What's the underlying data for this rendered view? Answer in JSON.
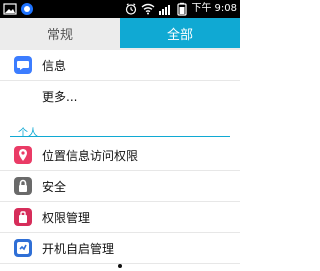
{
  "status_bar": {
    "period": "下午",
    "time": "9:08"
  },
  "tabs": {
    "general_label": "常规",
    "all_label": "全部"
  },
  "list_top": {
    "messages_label": "信息",
    "more_label": "更多..."
  },
  "section_personal": {
    "header": "个人",
    "items": [
      {
        "label": "位置信息访问权限",
        "icon": "location-pin-icon"
      },
      {
        "label": "安全",
        "icon": "lock-icon"
      },
      {
        "label": "权限管理",
        "icon": "permissions-icon"
      },
      {
        "label": "开机自启管理",
        "icon": "startup-icon"
      }
    ]
  },
  "colors": {
    "accent": "#10a9d3",
    "tab_inactive_bg": "#ececec",
    "status_bar_bg": "#000000",
    "location_icon": "#ea3b66",
    "permissions_icon": "#d62d5a",
    "lock_icon": "#6a6a6a",
    "startup_icon": "#2f6fd6",
    "messages_icon": "#3c7dff"
  }
}
